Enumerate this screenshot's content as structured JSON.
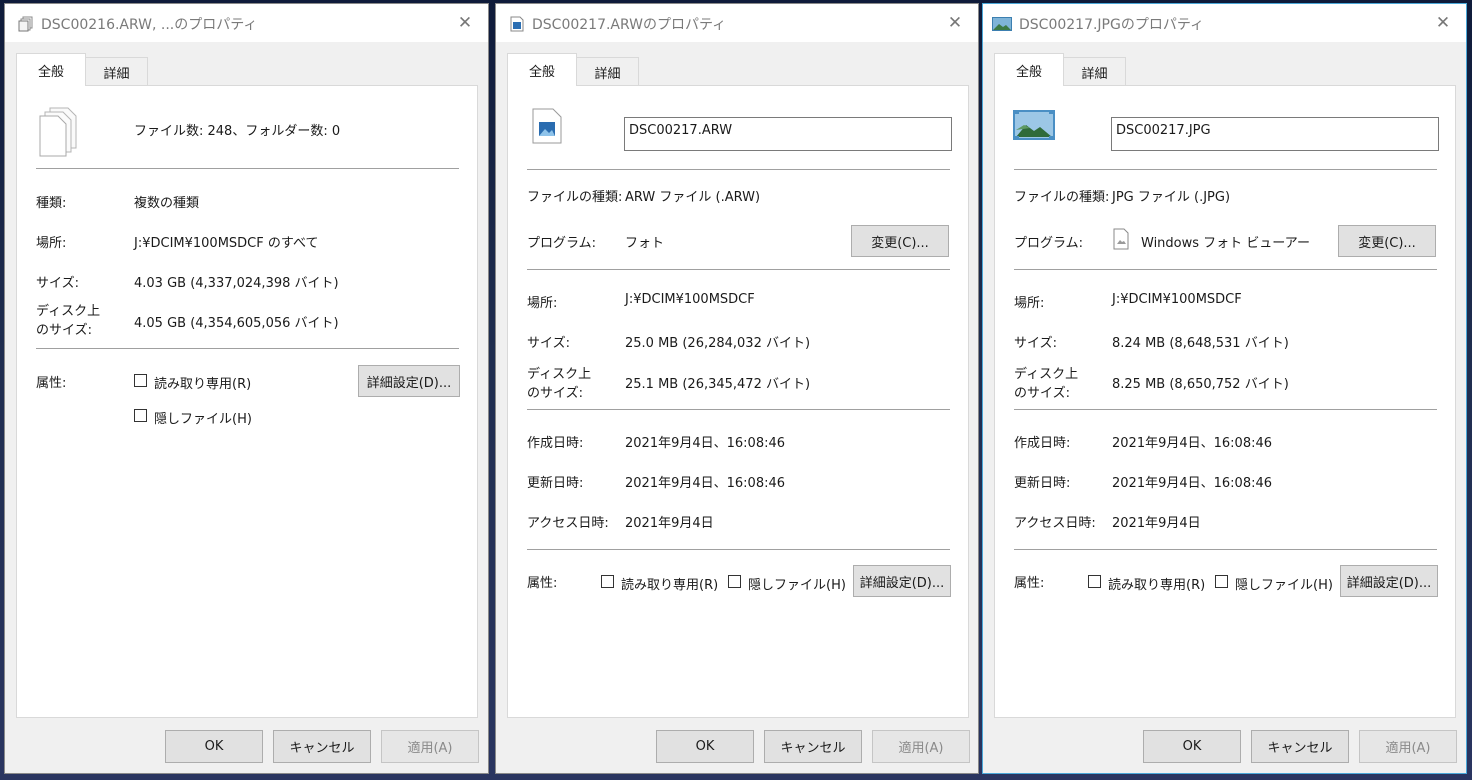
{
  "colors": {
    "accent_border": "#4ba8d8",
    "button_bg": "#e1e1e1",
    "panel_bg": "#ffffff"
  },
  "windows": [
    {
      "title": "DSC00216.ARW, ...のプロパティ",
      "title_icon": "multiple-files-icon",
      "tabs": [
        "全般",
        "詳細"
      ],
      "summary": "ファイル数: 248、フォルダー数: 0",
      "rows": [
        {
          "label": "種類:",
          "value": "複数の種類"
        },
        {
          "label": "場所:",
          "value": "J:¥DCIM¥100MSDCF のすべて"
        },
        {
          "label": "サイズ:",
          "value": "4.03 GB (4,337,024,398 バイト)"
        },
        {
          "label": "ディスク上\nのサイズ:",
          "value": "4.05 GB (4,354,605,056 バイト)"
        }
      ],
      "attributes": {
        "label": "属性:",
        "readonly": "読み取り専用(R)",
        "hidden": "隠しファイル(H)",
        "advanced": "詳細設定(D)..."
      },
      "buttons": {
        "ok": "OK",
        "cancel": "キャンセル",
        "apply": "適用(A)"
      }
    },
    {
      "title": "DSC00217.ARWのプロパティ",
      "title_icon": "image-file-icon",
      "tabs": [
        "全般",
        "詳細"
      ],
      "filename": "DSC00217.ARW",
      "type_label": "ファイルの種類:",
      "type_value": "ARW ファイル (.ARW)",
      "program_label": "プログラム:",
      "program_value": "フォト",
      "change_button": "変更(C)...",
      "rows": [
        {
          "label": "場所:",
          "value": "J:¥DCIM¥100MSDCF"
        },
        {
          "label": "サイズ:",
          "value": "25.0 MB (26,284,032 バイト)"
        },
        {
          "label": "ディスク上\nのサイズ:",
          "value": "25.1 MB (26,345,472 バイト)"
        }
      ],
      "dates": [
        {
          "label": "作成日時:",
          "value": "2021年9月4日、16:08:46"
        },
        {
          "label": "更新日時:",
          "value": "2021年9月4日、16:08:46"
        },
        {
          "label": "アクセス日時:",
          "value": "2021年9月4日"
        }
      ],
      "attributes": {
        "label": "属性:",
        "readonly": "読み取り専用(R)",
        "hidden": "隠しファイル(H)",
        "advanced": "詳細設定(D)..."
      },
      "buttons": {
        "ok": "OK",
        "cancel": "キャンセル",
        "apply": "適用(A)"
      }
    },
    {
      "title": "DSC00217.JPGのプロパティ",
      "title_icon": "landscape-image-icon",
      "tabs": [
        "全般",
        "詳細"
      ],
      "filename": "DSC00217.JPG",
      "type_label": "ファイルの種類:",
      "type_value": "JPG ファイル (.JPG)",
      "program_label": "プログラム:",
      "program_value": "Windows フォト ビューアー",
      "change_button": "変更(C)...",
      "rows": [
        {
          "label": "場所:",
          "value": "J:¥DCIM¥100MSDCF"
        },
        {
          "label": "サイズ:",
          "value": "8.24 MB (8,648,531 バイト)"
        },
        {
          "label": "ディスク上\nのサイズ:",
          "value": "8.25 MB (8,650,752 バイト)"
        }
      ],
      "dates": [
        {
          "label": "作成日時:",
          "value": "2021年9月4日、16:08:46"
        },
        {
          "label": "更新日時:",
          "value": "2021年9月4日、16:08:46"
        },
        {
          "label": "アクセス日時:",
          "value": "2021年9月4日"
        }
      ],
      "attributes": {
        "label": "属性:",
        "readonly": "読み取り専用(R)",
        "hidden": "隠しファイル(H)",
        "advanced": "詳細設定(D)..."
      },
      "buttons": {
        "ok": "OK",
        "cancel": "キャンセル",
        "apply": "適用(A)"
      }
    }
  ]
}
